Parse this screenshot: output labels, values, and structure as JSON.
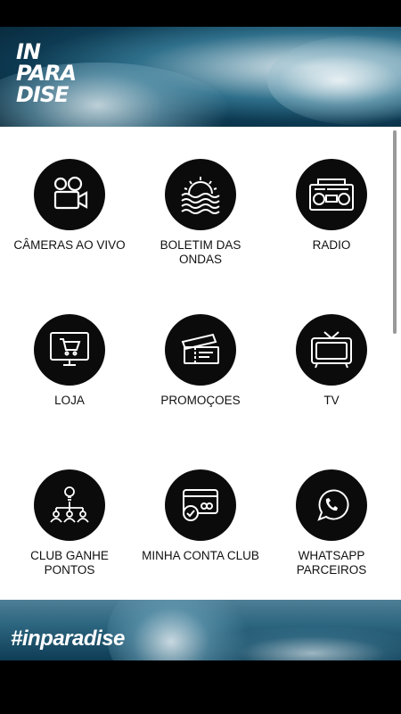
{
  "header": {
    "logo_lines": [
      "IN",
      "PARA",
      "DISE"
    ]
  },
  "menu": [
    {
      "label": "CÂMERAS AO VIVO",
      "icon": "camera-icon"
    },
    {
      "label": "BOLETIM DAS ONDAS",
      "icon": "sunset-waves-icon"
    },
    {
      "label": "RADIO",
      "icon": "radio-icon"
    },
    {
      "label": "LOJA",
      "icon": "shopping-cart-monitor-icon"
    },
    {
      "label": "PROMOÇOES",
      "icon": "tickets-icon"
    },
    {
      "label": "TV",
      "icon": "tv-icon"
    },
    {
      "label": "CLUB GANHE PONTOS",
      "icon": "people-network-icon"
    },
    {
      "label": "MINHA CONTA CLUB",
      "icon": "credit-card-check-icon"
    },
    {
      "label": "WHATSAPP PARCEIROS",
      "icon": "whatsapp-icon"
    }
  ],
  "footer": {
    "hashtag": "#inparadise"
  }
}
